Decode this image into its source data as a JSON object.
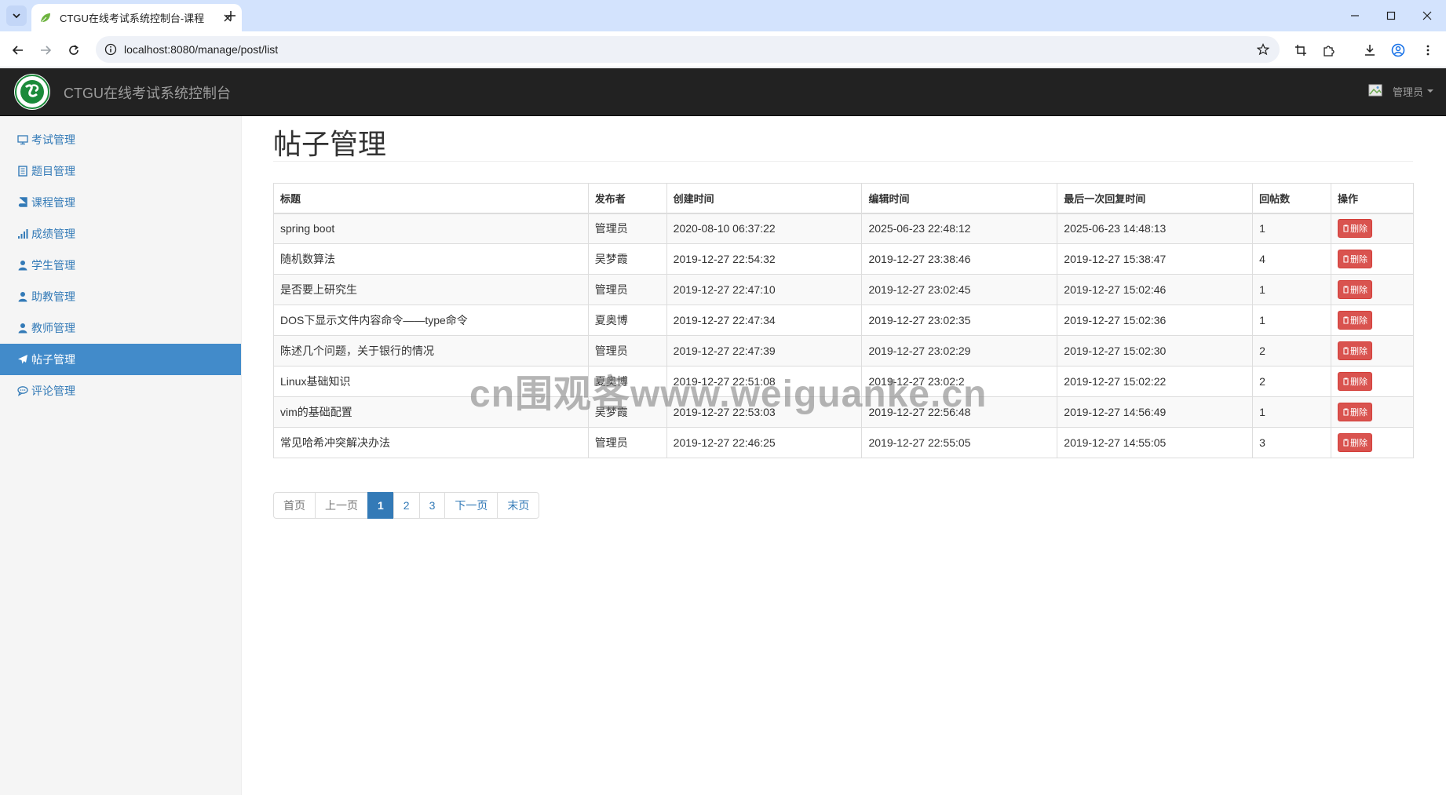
{
  "browser": {
    "tab_title": "CTGU在线考试系统控制台-课程",
    "url": "localhost:8080/manage/post/list"
  },
  "navbar": {
    "brand": "CTGU在线考试系统控制台",
    "user": "管理员"
  },
  "sidebar": {
    "items": [
      {
        "label": "考试管理",
        "icon": "monitor-icon"
      },
      {
        "label": "题目管理",
        "icon": "book-icon"
      },
      {
        "label": "课程管理",
        "icon": "book-icon"
      },
      {
        "label": "成绩管理",
        "icon": "signal-icon"
      },
      {
        "label": "学生管理",
        "icon": "user-icon"
      },
      {
        "label": "助教管理",
        "icon": "user-icon"
      },
      {
        "label": "教师管理",
        "icon": "user-icon"
      },
      {
        "label": "帖子管理",
        "icon": "send-icon",
        "active": true
      },
      {
        "label": "评论管理",
        "icon": "comment-icon"
      }
    ]
  },
  "page": {
    "title": "帖子管理"
  },
  "table": {
    "headers": [
      "标题",
      "发布者",
      "创建时间",
      "编辑时间",
      "最后一次回复时间",
      "回帖数",
      "操作"
    ],
    "delete_label": "删除",
    "rows": [
      {
        "title": "spring boot",
        "author": "管理员",
        "created": "2020-08-10 06:37:22",
        "edited": "2025-06-23 22:48:12",
        "last_reply": "2025-06-23 14:48:13",
        "replies": "1"
      },
      {
        "title": "随机数算法",
        "author": "吴梦霞",
        "created": "2019-12-27 22:54:32",
        "edited": "2019-12-27 23:38:46",
        "last_reply": "2019-12-27 15:38:47",
        "replies": "4"
      },
      {
        "title": "是否要上研究生",
        "author": "管理员",
        "created": "2019-12-27 22:47:10",
        "edited": "2019-12-27 23:02:45",
        "last_reply": "2019-12-27 15:02:46",
        "replies": "1"
      },
      {
        "title": "DOS下显示文件内容命令——type命令",
        "author": "夏奥博",
        "created": "2019-12-27 22:47:34",
        "edited": "2019-12-27 23:02:35",
        "last_reply": "2019-12-27 15:02:36",
        "replies": "1"
      },
      {
        "title": "陈述几个问题，关于银行的情况",
        "author": "管理员",
        "created": "2019-12-27 22:47:39",
        "edited": "2019-12-27 23:02:29",
        "last_reply": "2019-12-27 15:02:30",
        "replies": "2"
      },
      {
        "title": "Linux基础知识",
        "author": "夏奥博",
        "created": "2019-12-27 22:51:08",
        "edited": "2019-12-27 23:02:2",
        "last_reply": "2019-12-27 15:02:22",
        "replies": "2"
      },
      {
        "title": "vim的基础配置",
        "author": "吴梦霞",
        "created": "2019-12-27 22:53:03",
        "edited": "2019-12-27 22:56:48",
        "last_reply": "2019-12-27 14:56:49",
        "replies": "1"
      },
      {
        "title": "常见哈希冲突解决办法",
        "author": "管理员",
        "created": "2019-12-27 22:46:25",
        "edited": "2019-12-27 22:55:05",
        "last_reply": "2019-12-27 14:55:05",
        "replies": "3"
      }
    ]
  },
  "pagination": {
    "first": "首页",
    "prev": "上一页",
    "pages": [
      "1",
      "2",
      "3"
    ],
    "current": "1",
    "next": "下一页",
    "last": "末页"
  },
  "watermark": "cn围观客www.weiguanke.cn",
  "colors": {
    "navbar_bg": "#222222",
    "sidebar_active": "#428bca",
    "link": "#337ab7",
    "danger": "#d9534f"
  }
}
